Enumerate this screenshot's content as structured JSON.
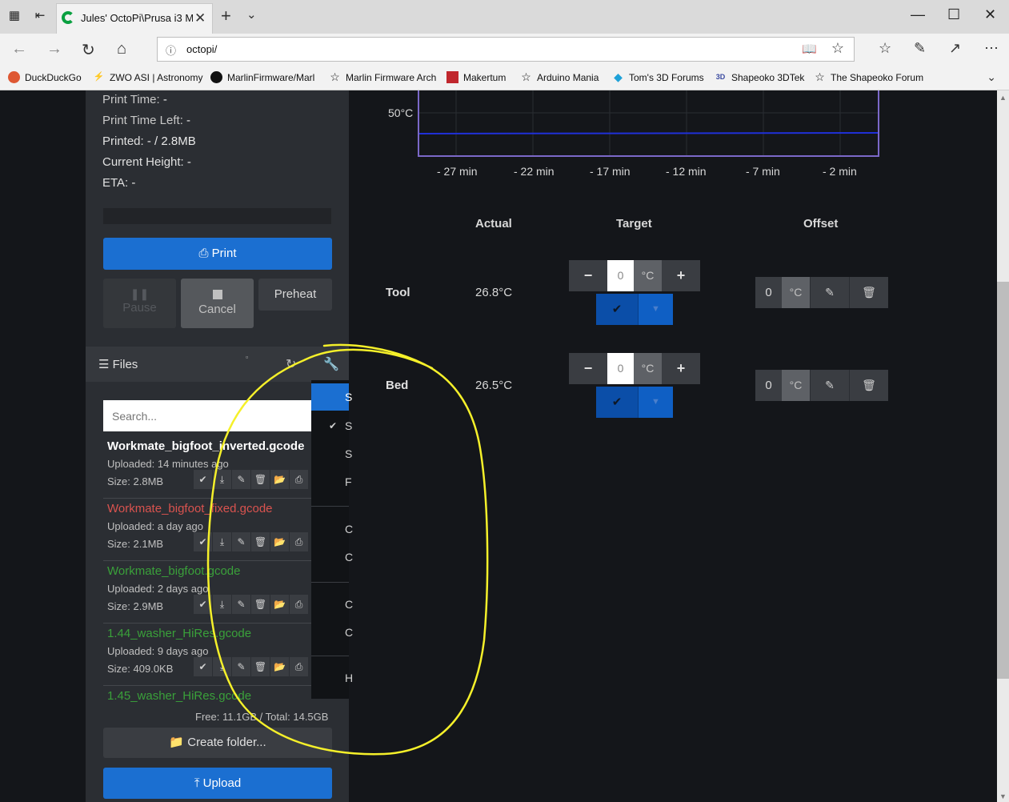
{
  "browser": {
    "tab_title": "Jules' OctoPi\\Prusa i3 M",
    "url": "octopi/",
    "favorites": [
      {
        "label": "DuckDuckGo",
        "icon": "duckduckgo-icon",
        "color": "#de5833"
      },
      {
        "label": "ZWO ASI | Astronomy",
        "icon": "zwo-icon",
        "color": "#333333"
      },
      {
        "label": "MarlinFirmware/Marl",
        "icon": "github-icon",
        "color": "#111111"
      },
      {
        "label": "Marlin Firmware Arch",
        "icon": "star-icon",
        "color": "#333333"
      },
      {
        "label": "Makertum",
        "icon": "makertum-icon",
        "color": "#c0272d"
      },
      {
        "label": "Arduino Mania",
        "icon": "star-icon",
        "color": "#333333"
      },
      {
        "label": "Tom's 3D Forums",
        "icon": "toms-icon",
        "color": "#1ea1d8"
      },
      {
        "label": "Shapeoko 3DTek",
        "icon": "3dtek-icon",
        "color": "#3a4aa0"
      },
      {
        "label": "The Shapeoko Forum",
        "icon": "star-icon",
        "color": "#333333"
      }
    ]
  },
  "state": {
    "print_time_label": "Print Time:",
    "print_time": "-",
    "print_time_left_label": "Print Time Left:",
    "print_time_left": "-",
    "printed_label": "Printed:",
    "printed": "- / 2.8MB",
    "current_height_label": "Current Height:",
    "current_height": "-",
    "eta_label": "ETA:",
    "eta": "-"
  },
  "controls": {
    "print": "Print",
    "pause": "Pause",
    "cancel": "Cancel",
    "preheat": "Preheat"
  },
  "files": {
    "title": "Files",
    "search_placeholder": "Search...",
    "items": [
      {
        "name": "Workmate_bigfoot_inverted.gcode",
        "uploaded": "Uploaded: 14 minutes ago",
        "size": "Size: 2.8MB",
        "color": "#ffffff",
        "bold": true
      },
      {
        "name": "Workmate_bigfoot_fixed.gcode",
        "uploaded": "Uploaded: a day ago",
        "size": "Size: 2.1MB",
        "color": "#d9534f",
        "bold": false
      },
      {
        "name": "Workmate_bigfoot.gcode",
        "uploaded": "Uploaded: 2 days ago",
        "size": "Size: 2.9MB",
        "color": "#3aa03a",
        "bold": false
      },
      {
        "name": "1.44_washer_HiRes.gcode",
        "uploaded": "Uploaded: 9 days ago",
        "size": "Size: 409.0KB",
        "color": "#3aa03a",
        "bold": false
      },
      {
        "name": "1.45_washer_HiRes.gcode",
        "uploaded": "",
        "size": "",
        "color": "#3aa03a",
        "bold": false
      }
    ],
    "free": "Free: 11.1GB / Total: 14.5GB",
    "create_folder": "Create folder...",
    "upload": "Upload"
  },
  "dropdown_items": [
    "S",
    "S",
    "S",
    "F",
    "C",
    "C",
    "C",
    "C",
    "H"
  ],
  "graph": {
    "y_label": "50°C",
    "x_ticks": [
      "- 27 min",
      "- 22 min",
      "- 17 min",
      "- 12 min",
      "- 7 min",
      "- 2 min"
    ]
  },
  "temps": {
    "headers": {
      "actual": "Actual",
      "target": "Target",
      "offset": "Offset"
    },
    "rows": [
      {
        "label": "Tool",
        "actual": "26.8°C",
        "target": "0",
        "unit": "°C",
        "offset": "0"
      },
      {
        "label": "Bed",
        "actual": "26.5°C",
        "target": "0",
        "unit": "°C",
        "offset": "0"
      }
    ]
  },
  "colors": {
    "accent": "#1b6fd1",
    "annotation": "#f5f02a",
    "sidebar": "#2b2e33",
    "background": "#14161a"
  }
}
